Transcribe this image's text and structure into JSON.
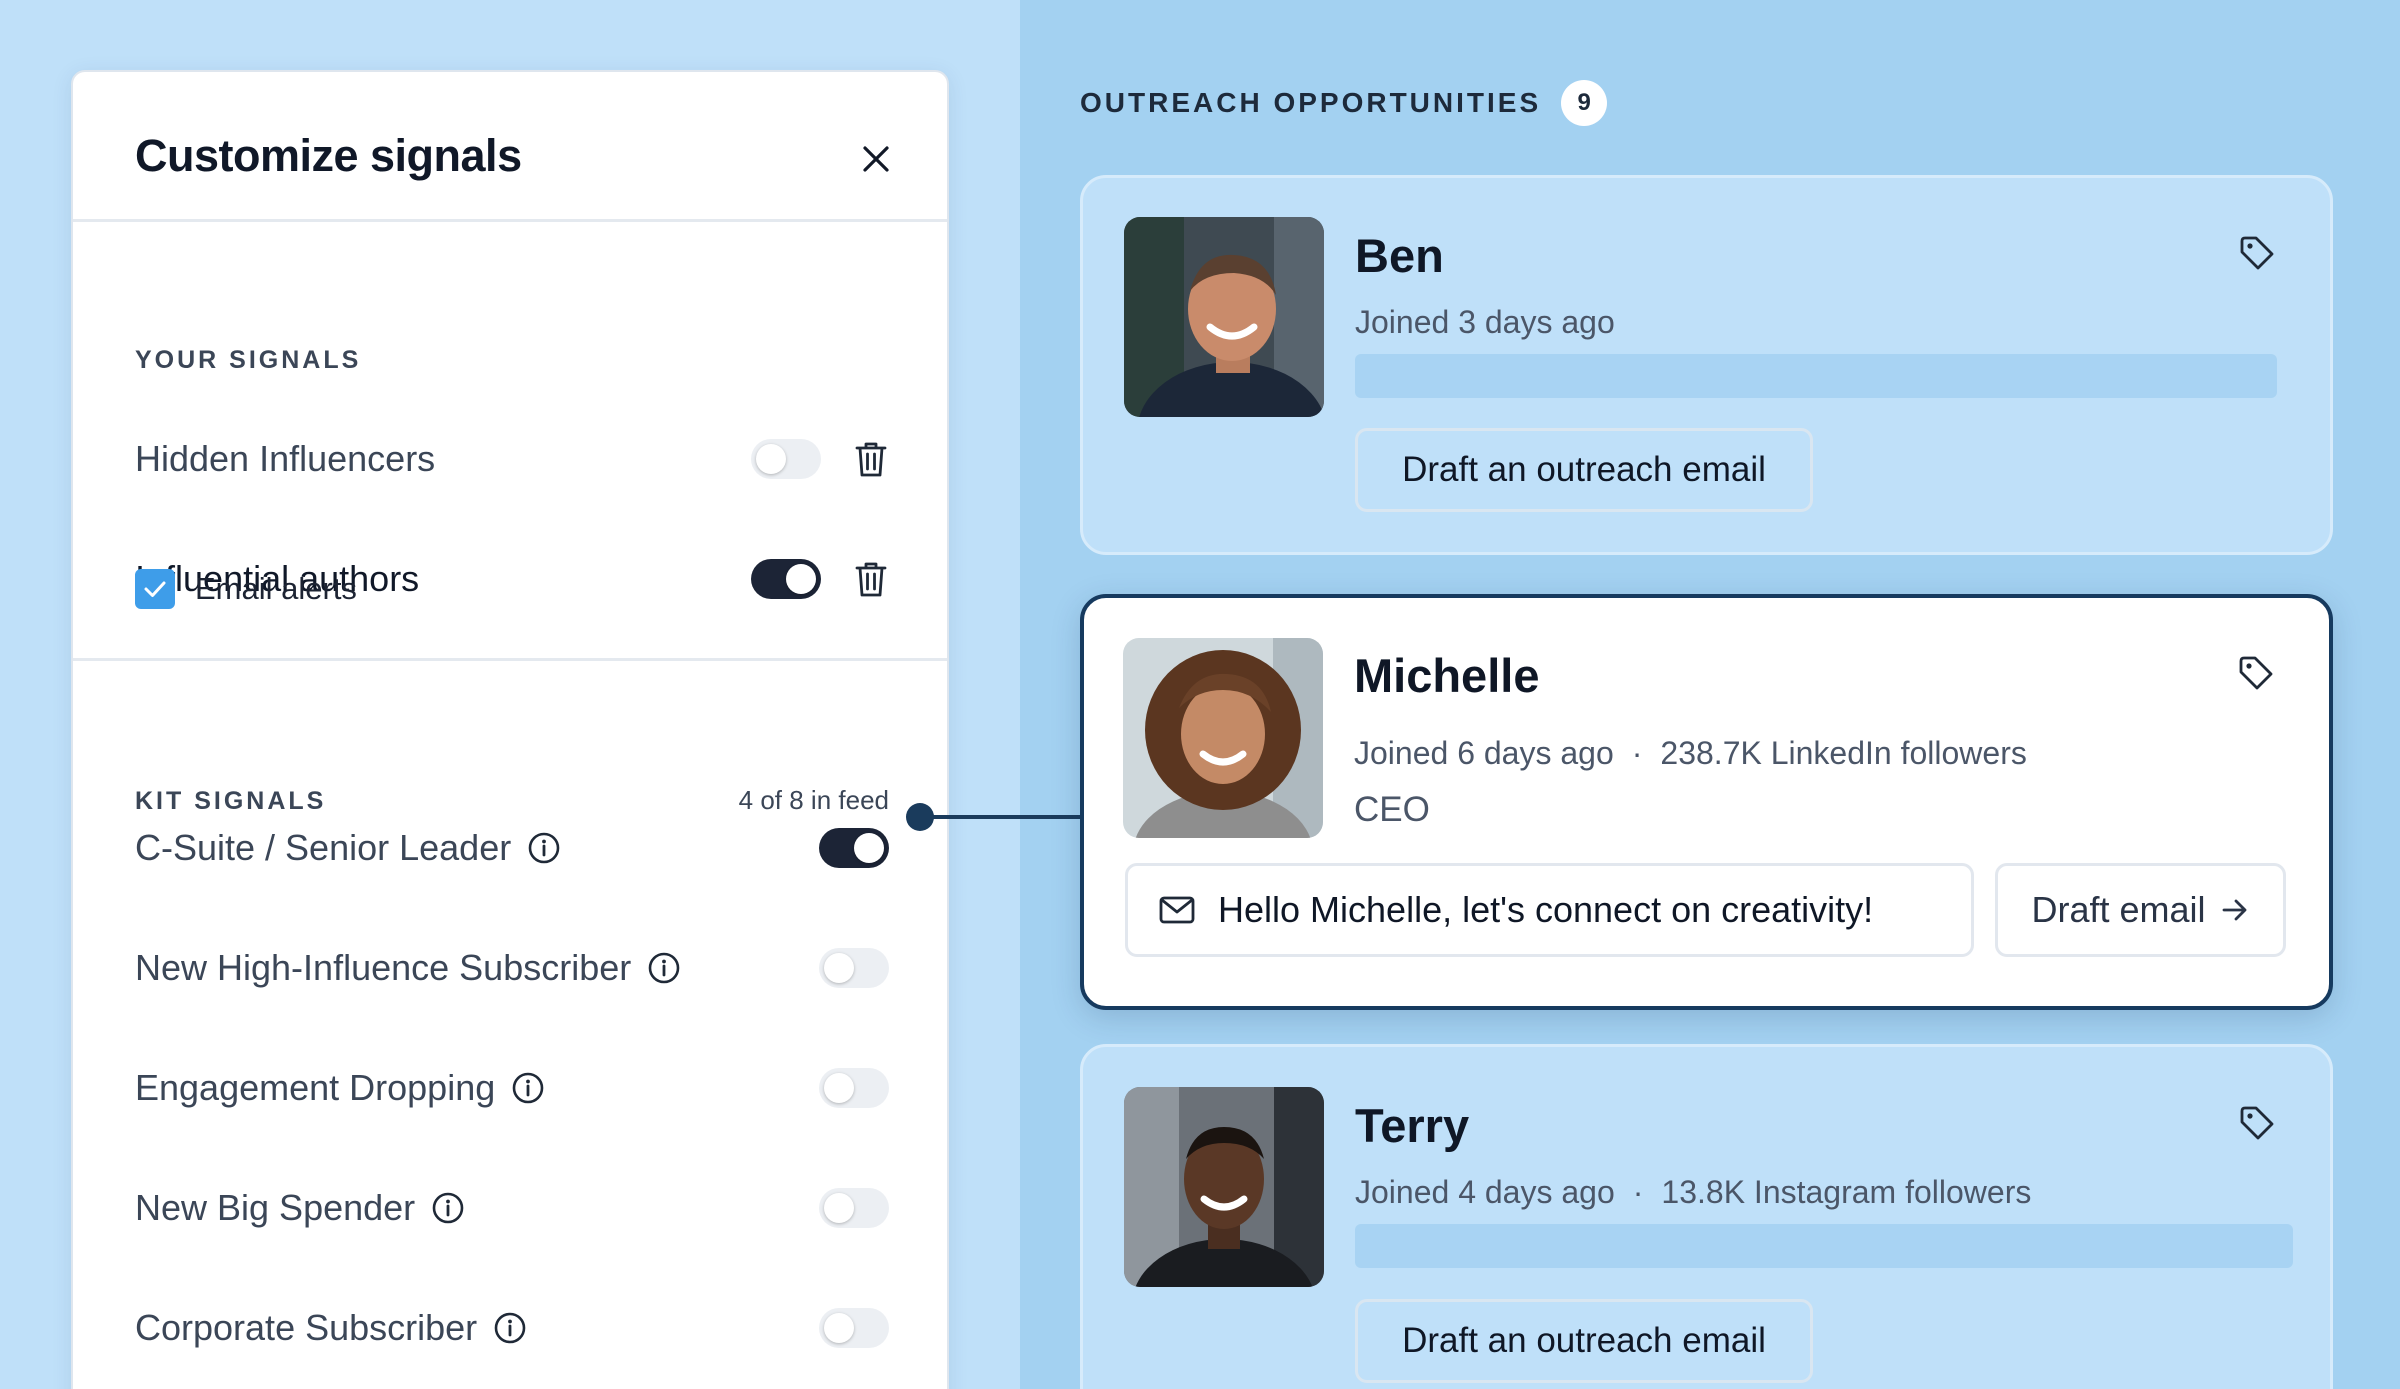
{
  "panel": {
    "title": "Customize signals",
    "your_signals": {
      "label": "YOUR SIGNALS",
      "items": [
        {
          "label": "Hidden Influencers",
          "enabled": false
        },
        {
          "label": "Influential authors",
          "enabled": true,
          "email_alerts": {
            "label": "Email alerts",
            "checked": true
          }
        }
      ]
    },
    "kit_signals": {
      "label": "KIT SIGNALS",
      "count_text": "4 of 8 in feed",
      "items": [
        {
          "label": "C-Suite / Senior Leader",
          "enabled": true
        },
        {
          "label": "New High-Influence Subscriber",
          "enabled": false
        },
        {
          "label": "Engagement Dropping",
          "enabled": false
        },
        {
          "label": "New Big Spender",
          "enabled": false
        },
        {
          "label": "Corporate Subscriber",
          "enabled": false
        }
      ]
    }
  },
  "outreach": {
    "title": "OUTREACH OPPORTUNITIES",
    "count": "9",
    "cards": [
      {
        "name": "Ben",
        "joined": "Joined 3 days ago",
        "button": "Draft an outreach email"
      },
      {
        "name": "Michelle",
        "joined": "Joined 6 days ago",
        "separator": "·",
        "followers": "238.7K LinkedIn followers",
        "role": "CEO",
        "email_preview": "Hello Michelle, let's connect on creativity!",
        "draft_button": "Draft email"
      },
      {
        "name": "Terry",
        "joined": "Joined 4 days ago",
        "separator": "·",
        "followers": "13.8K Instagram followers",
        "button": "Draft an outreach email"
      }
    ]
  },
  "colors": {
    "left_background": "#bfe0f9",
    "right_background": "#a3d1f1",
    "toggle_on": "#1c2436",
    "checkbox": "#3e9de9",
    "active_border": "#163a5f"
  },
  "icons": [
    "close-icon",
    "trash-icon",
    "info-icon",
    "check-icon",
    "tag-icon",
    "mail-icon",
    "arrow-right-icon"
  ]
}
